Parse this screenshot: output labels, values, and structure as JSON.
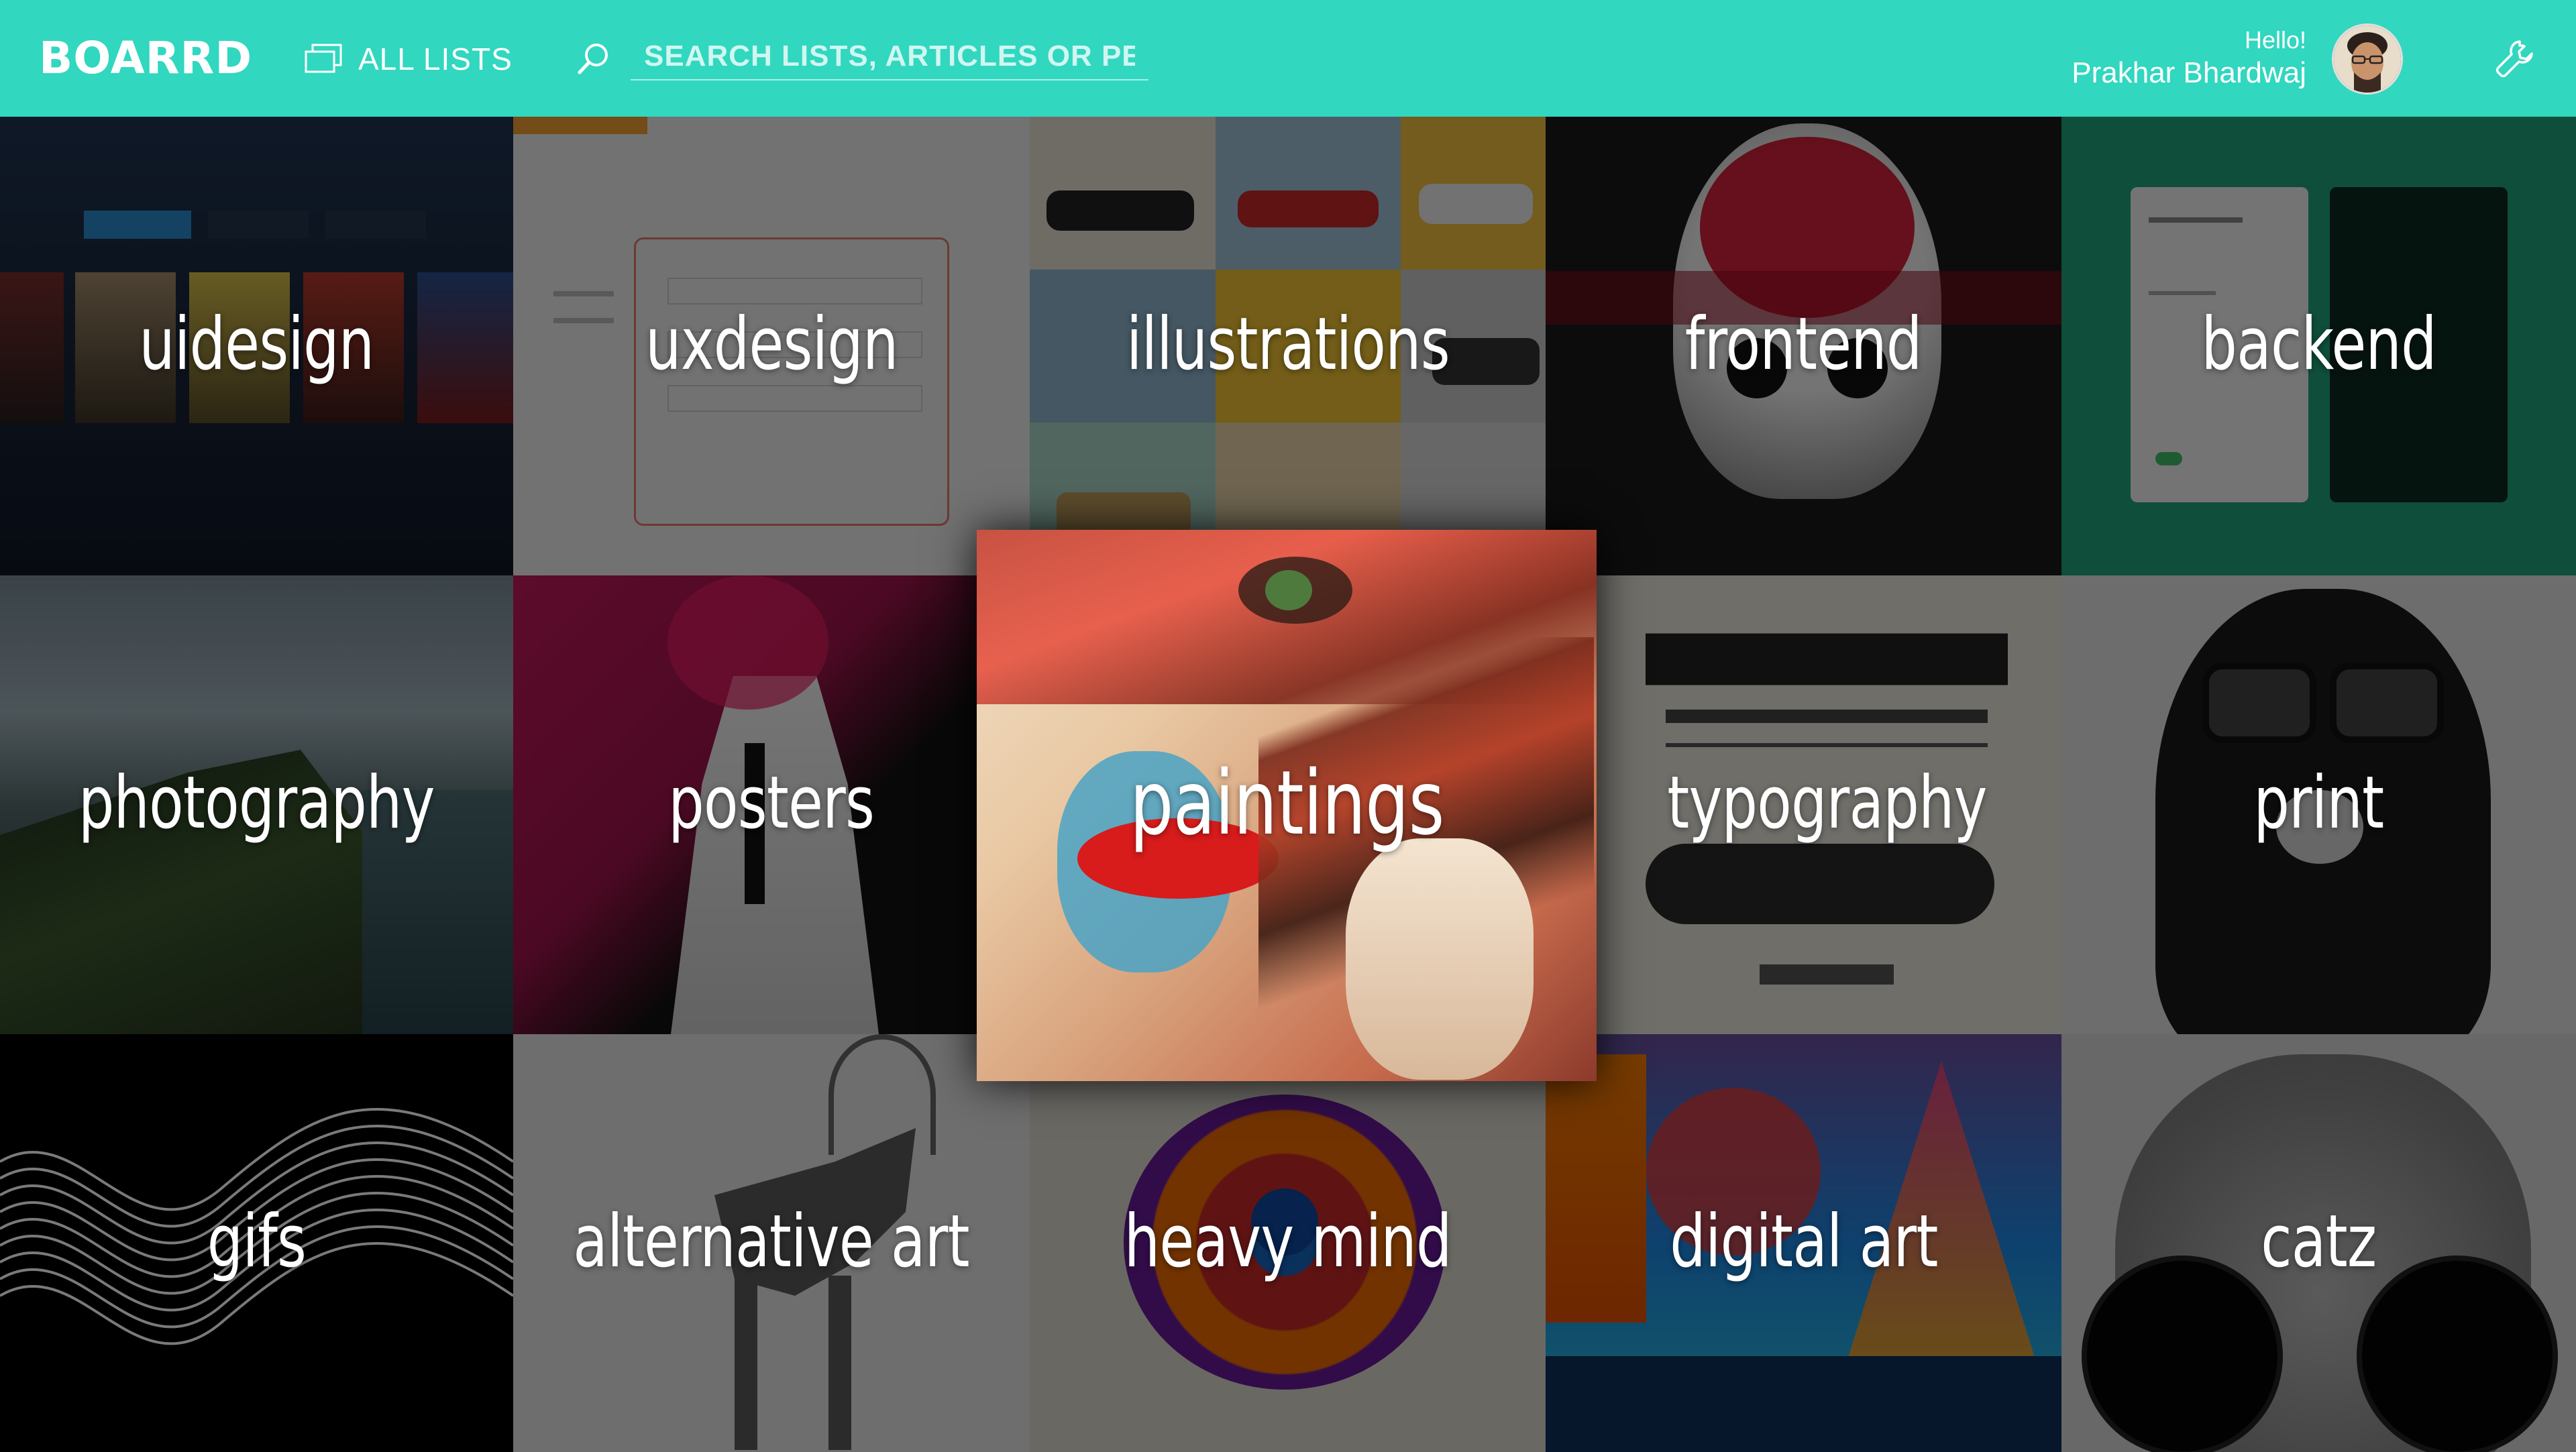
{
  "app": {
    "logo": "BOARRD",
    "brand_color": "#31d7bf"
  },
  "header": {
    "all_lists_label": "ALL LISTS",
    "all_lists_icon": "stacked-cards-icon",
    "search_icon": "search-icon",
    "search_placeholder": "SEARCH LISTS, ARTICLES OR PEOPLE",
    "greeting": "Hello!",
    "user_name": "Prakhar Bhardwaj",
    "settings_icon": "wrench-icon"
  },
  "tiles": [
    {
      "label": "uidesign"
    },
    {
      "label": "uxdesign"
    },
    {
      "label": "illustrations"
    },
    {
      "label": "frontend"
    },
    {
      "label": "backend"
    },
    {
      "label": "photography"
    },
    {
      "label": "posters"
    },
    {
      "label": "paintings"
    },
    {
      "label": "typography"
    },
    {
      "label": "print"
    },
    {
      "label": "gifs"
    },
    {
      "label": "alternative art"
    },
    {
      "label": "heavy mind"
    },
    {
      "label": "digital art"
    },
    {
      "label": "catz"
    }
  ]
}
